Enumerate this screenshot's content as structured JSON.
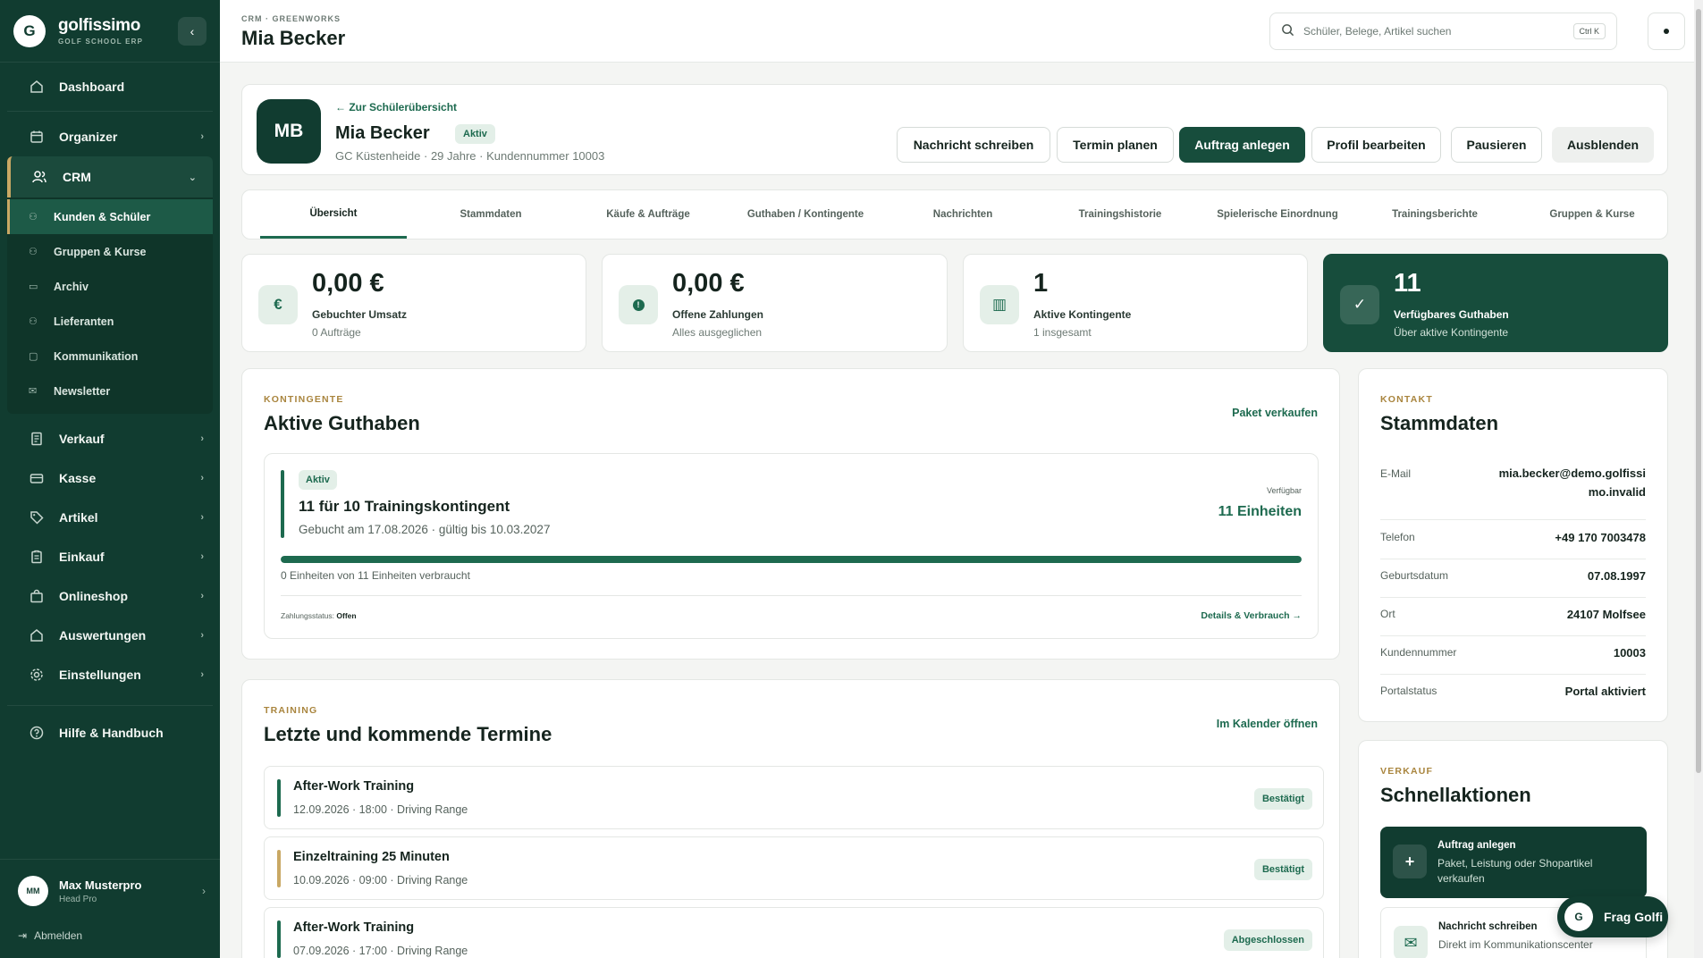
{
  "app": {
    "logo_letter": "G",
    "name": "golfissimo",
    "subtitle": "GOLF SCHOOL ERP",
    "collapse_icon": "chevron-left-icon"
  },
  "sidebar": {
    "dashboard": "Dashboard",
    "organizer": "Organizer",
    "crm": "CRM",
    "crm_items": [
      "Kunden & Schüler",
      "Gruppen & Kurse",
      "Archiv",
      "Lieferanten",
      "Kommunikation",
      "Newsletter"
    ],
    "sections": [
      "Verkauf",
      "Kasse",
      "Artikel",
      "Einkauf",
      "Onlineshop",
      "Auswertungen",
      "Einstellungen"
    ],
    "help": "Hilfe & Handbuch",
    "user": {
      "initials": "MM",
      "name": "Max Musterpro",
      "role": "Head Pro"
    },
    "logout": "Abmelden"
  },
  "topbar": {
    "breadcrumb": "CRM · GREENWORKS",
    "title": "Mia Becker",
    "search_placeholder": "Schüler, Belege, Artikel suchen",
    "shortcut": "Ctrl K"
  },
  "profile": {
    "initials": "MB",
    "back": "← Zur Schülerübersicht",
    "name": "Mia Becker",
    "status": "Aktiv",
    "meta": "GC Küstenheide · 29 Jahre · Kundennummer 10003",
    "actions": [
      "Nachricht schreiben",
      "Termin planen",
      "Auftrag anlegen",
      "Profil bearbeiten",
      "Pausieren",
      "Ausblenden"
    ]
  },
  "tabs": [
    "Übersicht",
    "Stammdaten",
    "Käufe & Aufträge",
    "Guthaben / Kontingente",
    "Nachrichten",
    "Trainingshistorie",
    "Spielerische Einordnung",
    "Trainingsberichte",
    "Gruppen & Kurse"
  ],
  "kpis": [
    {
      "icon": "€",
      "value": "0,00 €",
      "label": "Gebuchter Umsatz",
      "sub": "0 Aufträge"
    },
    {
      "icon": "!",
      "value": "0,00 €",
      "label": "Offene Zahlungen",
      "sub": "Alles ausgeglichen"
    },
    {
      "icon": "▥",
      "value": "1",
      "label": "Aktive Kontingente",
      "sub": "1 insgesamt"
    },
    {
      "icon": "✓",
      "value": "11",
      "label": "Verfügbares Guthaben",
      "sub": "Über aktive Kontingente"
    }
  ],
  "contingents": {
    "eyebrow": "KONTINGENTE",
    "title": "Aktive Guthaben",
    "link": "Paket verkaufen",
    "item": {
      "status": "Aktiv",
      "title": "11 für 10 Trainingskontingent",
      "sub": "Gebucht am 17.08.2026 · gültig bis 10.03.2027",
      "right_label": "Verfügbar",
      "right_value": "11 Einheiten",
      "progress_remaining": 1.0,
      "progress_text": "0 Einheiten von 11 Einheiten verbraucht",
      "payment_label": "Zahlungsstatus:",
      "payment_value": "Offen",
      "details": "Details & Verbrauch →"
    }
  },
  "contact": {
    "eyebrow": "KONTAKT",
    "title": "Stammdaten",
    "rows": [
      {
        "key": "E-Mail",
        "value": "mia.becker@demo.golfissimo.invalid"
      },
      {
        "key": "Telefon",
        "value": "+49 170 7003478"
      },
      {
        "key": "Geburtsdatum",
        "value": "07.08.1997"
      },
      {
        "key": "Ort",
        "value": "24107 Molfsee"
      },
      {
        "key": "Kundennummer",
        "value": "10003"
      },
      {
        "key": "Portalstatus",
        "value": "Portal aktiviert"
      }
    ]
  },
  "training": {
    "eyebrow": "TRAINING",
    "title": "Letzte und kommende Termine",
    "link": "Im Kalender öffnen",
    "items": [
      {
        "title": "After-Work Training",
        "sub": "12.09.2026 · 18:00 · Driving Range",
        "badge": "Bestätigt",
        "color": "#1d6a4f"
      },
      {
        "title": "Einzeltraining 25 Minuten",
        "sub": "10.09.2026 · 09:00 · Driving Range",
        "badge": "Bestätigt",
        "color": "#c9a864"
      },
      {
        "title": "After-Work Training",
        "sub": "07.09.2026 · 17:00 · Driving Range",
        "badge": "Abgeschlossen",
        "color": "#1d6a4f"
      }
    ]
  },
  "quick": {
    "eyebrow": "VERKAUF",
    "title": "Schnellaktionen",
    "items": [
      {
        "icon": "+",
        "title": "Auftrag anlegen",
        "sub": "Paket, Leistung oder Shopartikel verkaufen"
      },
      {
        "icon": "✉",
        "title": "Nachricht schreiben",
        "sub": "Direkt im Kommunikationscenter"
      }
    ]
  },
  "assistant": {
    "logo": "G",
    "label": "Frag Golfi"
  },
  "colors": {
    "brand": "#113c30",
    "accent": "#1d6a4f",
    "gold": "#c9a864"
  }
}
